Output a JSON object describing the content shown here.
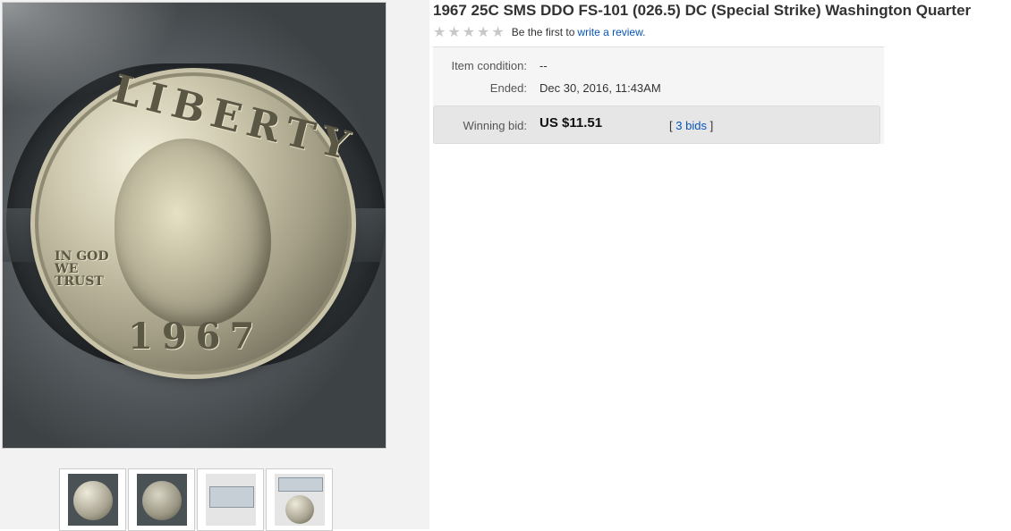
{
  "item": {
    "title": "1967 25C SMS DDO FS-101 (026.5) DC (Special Strike) Washington Quarter",
    "rating": {
      "stars": 0,
      "max_stars": 5,
      "prefix_text": "Be the first to",
      "review_link": "write a review."
    },
    "condition": {
      "label": "Item condition:",
      "value": "--"
    },
    "ended": {
      "label": "Ended:",
      "date": "Dec 30, 2016",
      "separator": ",",
      "time": "11:43AM"
    },
    "winning_bid": {
      "label": "Winning bid:",
      "price": "US $11.51",
      "bids_open": "[",
      "bids_link": "3 bids",
      "bids_close": "]"
    }
  },
  "gallery": {
    "main_image": {
      "subject": "1967 Washington quarter obverse in slab",
      "coin_legend": "LIBERTY",
      "coin_motto": "IN GOD WE TRUST",
      "coin_year": "1967"
    },
    "thumbnails": [
      {
        "subject": "obverse"
      },
      {
        "subject": "reverse"
      },
      {
        "subject": "slab label"
      },
      {
        "subject": "slab front"
      }
    ]
  },
  "colors": {
    "link": "#0654ba",
    "title": "#333333",
    "panel": "#f5f5f5",
    "bid_box": "#e6e6e6",
    "star_empty": "#c8c8c8"
  },
  "icons": {
    "star": "star-icon"
  }
}
